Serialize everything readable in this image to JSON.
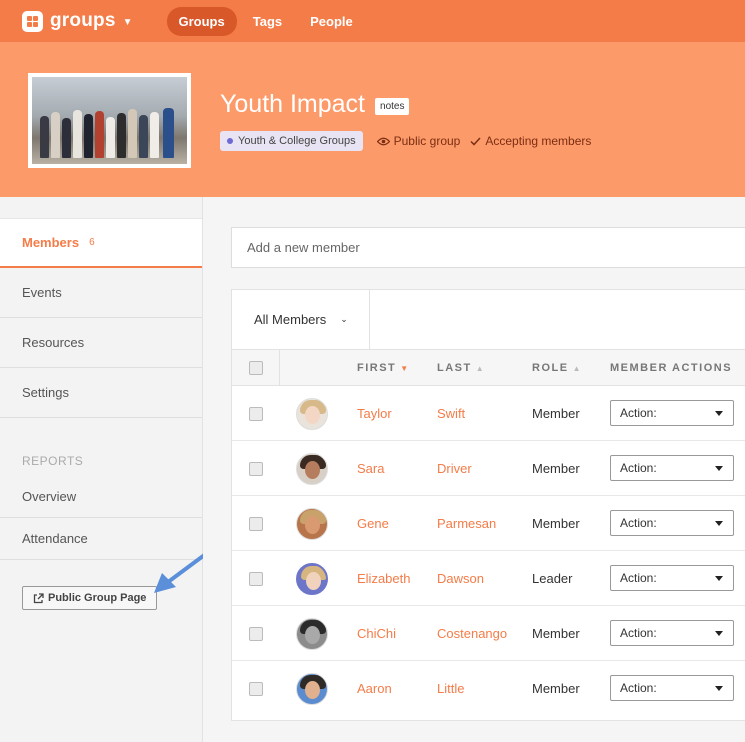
{
  "topnav": {
    "brand": "groups",
    "links": [
      {
        "label": "Groups",
        "active": true
      },
      {
        "label": "Tags",
        "active": false
      },
      {
        "label": "People",
        "active": false
      }
    ]
  },
  "header": {
    "title": "Youth Impact",
    "badge": "notes",
    "category": "Youth & College Groups",
    "visibility": "Public group",
    "membership": "Accepting members"
  },
  "sidebar": {
    "members_label": "Members",
    "members_count": "6",
    "events": "Events",
    "resources": "Resources",
    "settings": "Settings",
    "reports_heading": "REPORTS",
    "overview": "Overview",
    "attendance": "Attendance",
    "public_page_button": "Public Group Page"
  },
  "main": {
    "add_member_placeholder": "Add a new member",
    "filter": "All Members",
    "columns": {
      "first": "FIRST",
      "last": "LAST",
      "role": "ROLE",
      "actions": "MEMBER ACTIONS"
    },
    "action_placeholder": "Action:",
    "members": [
      {
        "first": "Taylor",
        "last": "Swift",
        "role": "Member"
      },
      {
        "first": "Sara",
        "last": "Driver",
        "role": "Member"
      },
      {
        "first": "Gene",
        "last": "Parmesan",
        "role": "Member"
      },
      {
        "first": "Elizabeth",
        "last": "Dawson",
        "role": "Leader"
      },
      {
        "first": "ChiChi",
        "last": "Costenango",
        "role": "Member"
      },
      {
        "first": "Aaron",
        "last": "Little",
        "role": "Member"
      }
    ]
  },
  "colors": {
    "brand": "#f47c48",
    "header_bg": "#fd9a6a",
    "nav_active": "#d9582a",
    "arrow": "#5b8fd9"
  }
}
